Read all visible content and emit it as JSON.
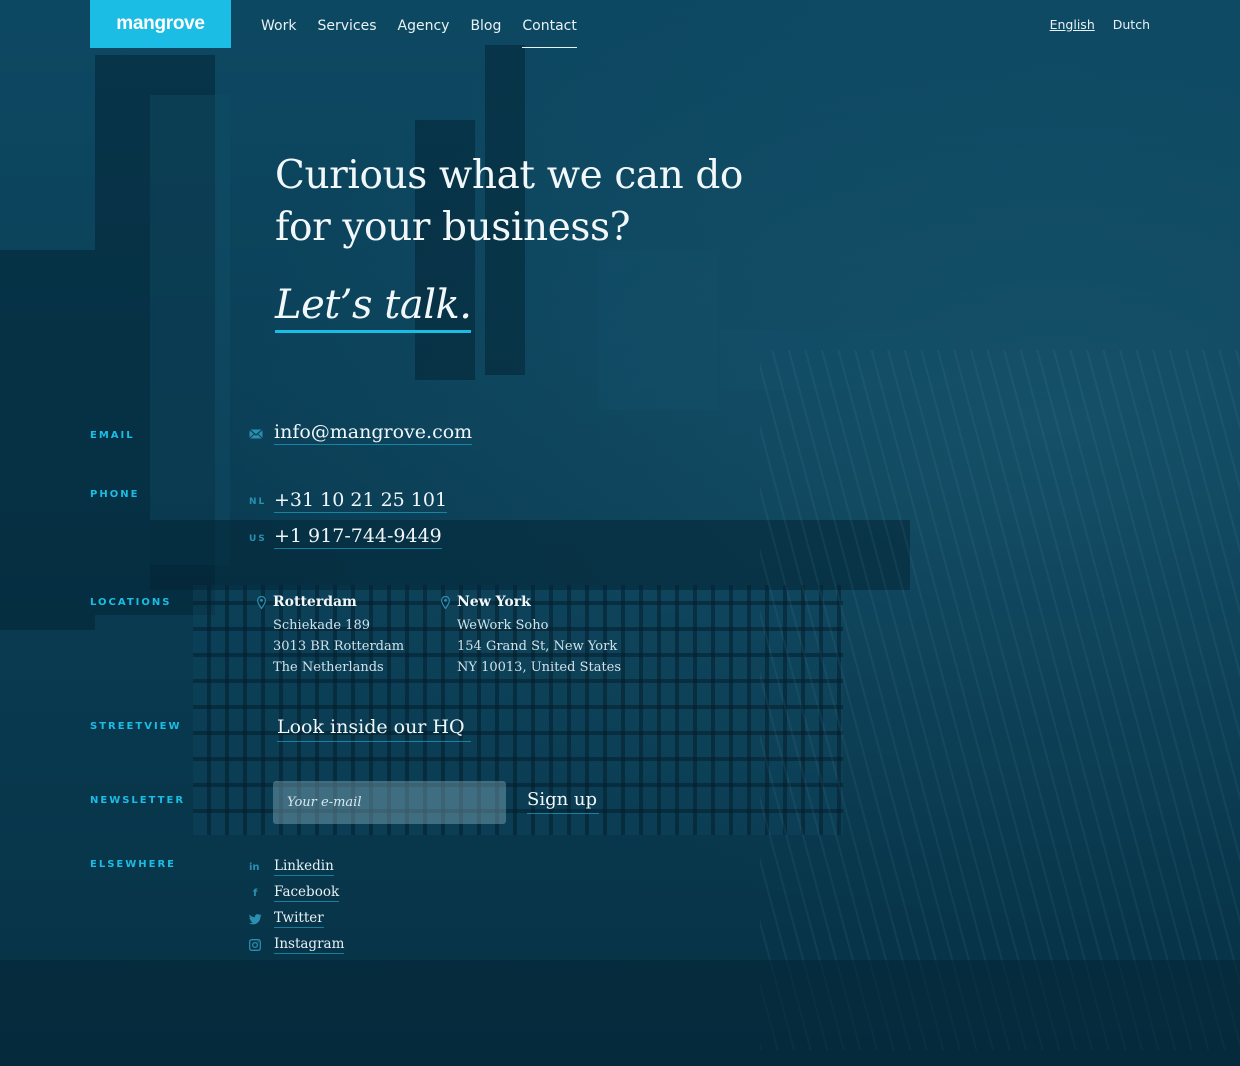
{
  "brand": {
    "logo_text": "mangrove",
    "accent_color": "#1bbde4"
  },
  "nav": {
    "items": [
      {
        "label": "Work"
      },
      {
        "label": "Services"
      },
      {
        "label": "Agency"
      },
      {
        "label": "Blog"
      },
      {
        "label": "Contact",
        "active": true
      }
    ]
  },
  "languages": [
    {
      "label": "English",
      "active": true
    },
    {
      "label": "Dutch"
    }
  ],
  "hero": {
    "line1": "Curious what we can do",
    "line2": "for your business?",
    "tagline": "Let’s talk."
  },
  "contact": {
    "email": {
      "label": "EMAIL",
      "icon": "envelope-icon",
      "value": "info@mangrove.com"
    },
    "phone": {
      "label": "PHONE",
      "numbers": [
        {
          "country": "NL",
          "number": "+31 10 21 25 101"
        },
        {
          "country": "US",
          "number": "+1 917-744-9449"
        }
      ]
    },
    "locations": {
      "label": "LOCATIONS",
      "offices": [
        {
          "city": "Rotterdam",
          "lines": [
            "Schiekade 189",
            "3013 BR Rotterdam",
            "The Netherlands"
          ]
        },
        {
          "city": "New York",
          "lines": [
            "WeWork Soho",
            "154 Grand St, New York",
            "NY 10013, United States"
          ]
        }
      ]
    },
    "streetview": {
      "label": "STREETVIEW",
      "link": "Look inside our HQ"
    },
    "newsletter": {
      "label": "NEWSLETTER",
      "placeholder": "Your e-mail",
      "button": "Sign up"
    },
    "elsewhere": {
      "label": "ELSEWHERE",
      "links": [
        {
          "name": "Linkedin",
          "icon": "linkedin-icon",
          "glyph": "in"
        },
        {
          "name": "Facebook",
          "icon": "facebook-icon",
          "glyph": "f"
        },
        {
          "name": "Twitter",
          "icon": "twitter-icon"
        },
        {
          "name": "Instagram",
          "icon": "instagram-icon"
        }
      ]
    }
  }
}
